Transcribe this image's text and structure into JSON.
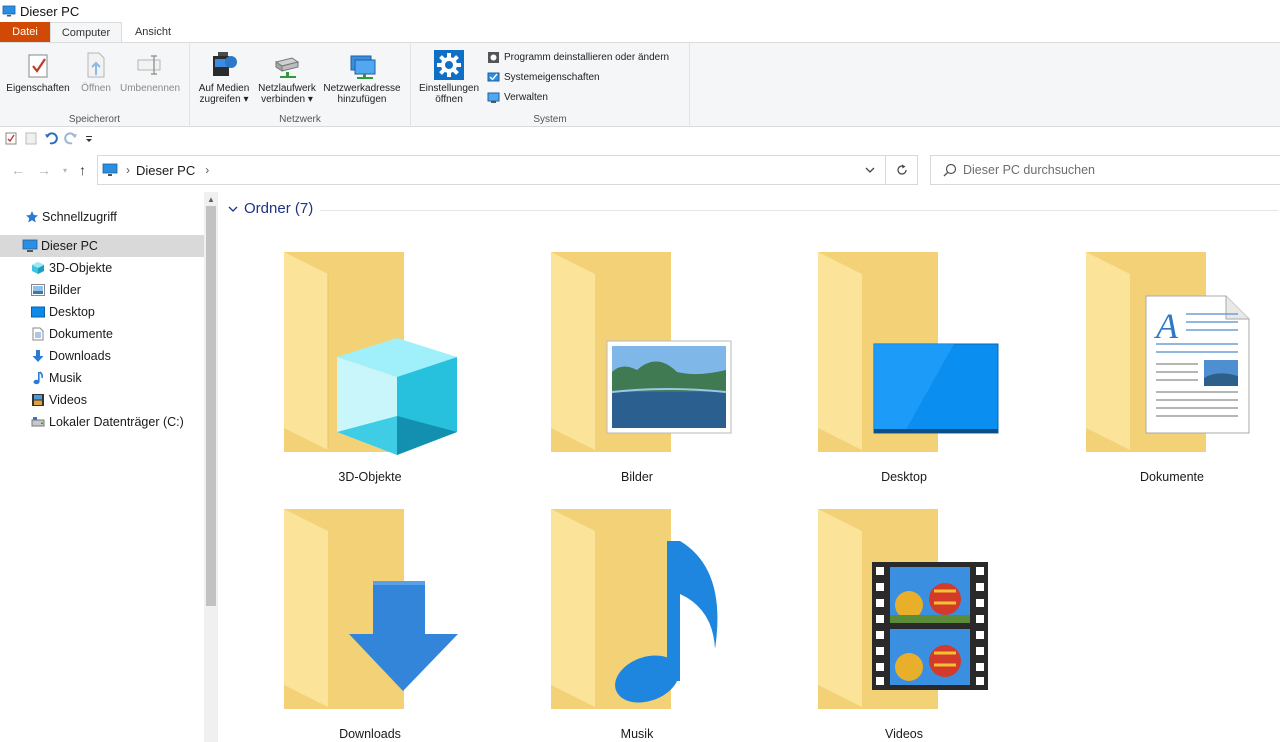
{
  "window": {
    "title": "Dieser PC"
  },
  "tabs": [
    {
      "label": "Datei"
    },
    {
      "label": "Computer"
    },
    {
      "label": "Ansicht"
    }
  ],
  "ribbon": {
    "speicherort": {
      "label": "Speicherort",
      "eigenschaften": "Eigenschaften",
      "oeffnen": "Öffnen",
      "umbenennen": "Umbenennen"
    },
    "netzwerk": {
      "label": "Netzwerk",
      "medien_line1": "Auf Medien",
      "medien_line2": "zugreifen ▾",
      "netzlaufwerk_line1": "Netzlaufwerk",
      "netzlaufwerk_line2": "verbinden ▾",
      "netzwerkadresse_line1": "Netzwerkadresse",
      "netzwerkadresse_line2": "hinzufügen"
    },
    "system": {
      "label": "System",
      "einstellungen_line1": "Einstellungen",
      "einstellungen_line2": "öffnen",
      "programm": "Programm deinstallieren oder ändern",
      "systemeigenschaften": "Systemeigenschaften",
      "verwalten": "Verwalten"
    }
  },
  "address": {
    "crumb": "Dieser PC"
  },
  "search": {
    "placeholder": "Dieser PC durchsuchen"
  },
  "sidebar": {
    "items": [
      {
        "label": "Schnellzugriff",
        "icon": "star-icon"
      },
      {
        "label": "Dieser PC",
        "icon": "pc-icon"
      },
      {
        "label": "3D-Objekte",
        "icon": "cube-icon"
      },
      {
        "label": "Bilder",
        "icon": "pictures-icon"
      },
      {
        "label": "Desktop",
        "icon": "desktop-icon"
      },
      {
        "label": "Dokumente",
        "icon": "documents-icon"
      },
      {
        "label": "Downloads",
        "icon": "download-icon"
      },
      {
        "label": "Musik",
        "icon": "music-icon"
      },
      {
        "label": "Videos",
        "icon": "videos-icon"
      },
      {
        "label": "Lokaler Datenträger (C:)",
        "icon": "drive-icon"
      }
    ]
  },
  "content": {
    "section_title": "Ordner (7)",
    "folders": [
      {
        "label": "3D-Objekte"
      },
      {
        "label": "Bilder"
      },
      {
        "label": "Desktop"
      },
      {
        "label": "Dokumente"
      },
      {
        "label": "Downloads"
      },
      {
        "label": "Musik"
      },
      {
        "label": "Videos"
      }
    ]
  },
  "colors": {
    "accent": "#1e3287",
    "file_tab": "#d04a05",
    "folder_back": "#f4d67a",
    "folder_front": "#fbe6a5",
    "selected": "#d9d9d9"
  }
}
